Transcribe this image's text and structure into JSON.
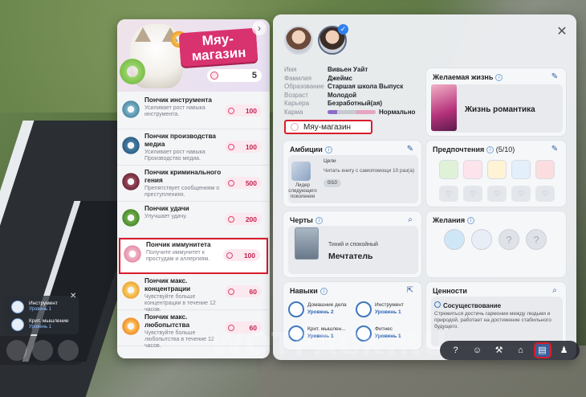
{
  "shop": {
    "title": "Мяу-магазин",
    "balance": "5",
    "items": [
      {
        "name": "Пончик инструмента",
        "desc": "Усиливает рост навыка инструмента.",
        "price": "100",
        "icon": "tool-donut-icon"
      },
      {
        "name": "Пончик производства медиа",
        "desc": "Усиливает рост навыка Производство медиа.",
        "price": "100",
        "icon": "media-donut-icon"
      },
      {
        "name": "Пончик криминального гения",
        "desc": "Препятствует сообщениям о преступлениях.",
        "price": "500",
        "icon": "crime-donut-icon"
      },
      {
        "name": "Пончик удачи",
        "desc": "Улучшает удачу.",
        "price": "200",
        "icon": "luck-donut-icon"
      },
      {
        "name": "Пончик иммунитета",
        "desc": "Получите иммунитет к простудам и аллергиям.",
        "price": "100",
        "icon": "immunity-donut-icon"
      },
      {
        "name": "Пончик макс. концентрации",
        "desc": "Чувствуйте больше концентрации в течение 12 часов.",
        "price": "60",
        "icon": "focus-donut-icon"
      },
      {
        "name": "Пончик макс. любопытства",
        "desc": "Чувствуйте больше любопытства в течение 12 часов.",
        "price": "60",
        "icon": "curiosity-donut-icon"
      }
    ]
  },
  "profile": {
    "info": [
      {
        "label": "Имя",
        "value": "Вивьен Уайт"
      },
      {
        "label": "Фамилия",
        "value": "Джеймс"
      },
      {
        "label": "Образование",
        "value": "Старшая школа Выпуск"
      },
      {
        "label": "Возраст",
        "value": "Молодой"
      },
      {
        "label": "Карьера",
        "value": "Безработный(ая)"
      },
      {
        "label": "Карма",
        "value": "Нормально"
      }
    ],
    "career_box": "Мяу-магазин"
  },
  "aspiration": {
    "title": "Желаемая жизнь",
    "label": "Жизнь романтика"
  },
  "ambitions": {
    "title": "Амбиции",
    "name": "Лидер следующего поколения",
    "goals_label": "Цели",
    "task": "Читать книгу с самопомощи 10 раз(а)",
    "progress": "0/10"
  },
  "preferences": {
    "title": "Предпочтения",
    "count": "(5/10)"
  },
  "traits": {
    "title": "Черты",
    "subtitle": "Тихий и спокойный",
    "name": "Мечтатель"
  },
  "wishes": {
    "title": "Желания"
  },
  "skills": {
    "title": "Навыки",
    "items": [
      {
        "name": "Домашние дела",
        "level": "Уровень 2"
      },
      {
        "name": "Инструмент",
        "level": "Уровень 1"
      },
      {
        "name": "Крит. мышлен...",
        "level": "Уровень 1"
      },
      {
        "name": "Фитнес",
        "level": "Уровень 1"
      }
    ]
  },
  "values": {
    "title": "Ценности",
    "name": "Сосуществование",
    "desc": "Стремиться достичь гармонии между людьми и природой, работает на достижение стабильного будущего."
  },
  "mini_skills": [
    {
      "name": "Инструмент",
      "level": "Уровень 1"
    },
    {
      "name": "Крит. мышление",
      "level": "Уровень 1"
    }
  ],
  "watermark": "WOTPACK.RU",
  "colors": {
    "accent_red": "#d91c2b",
    "shop_pink": "#d8326f",
    "link_blue": "#2e66b5"
  }
}
